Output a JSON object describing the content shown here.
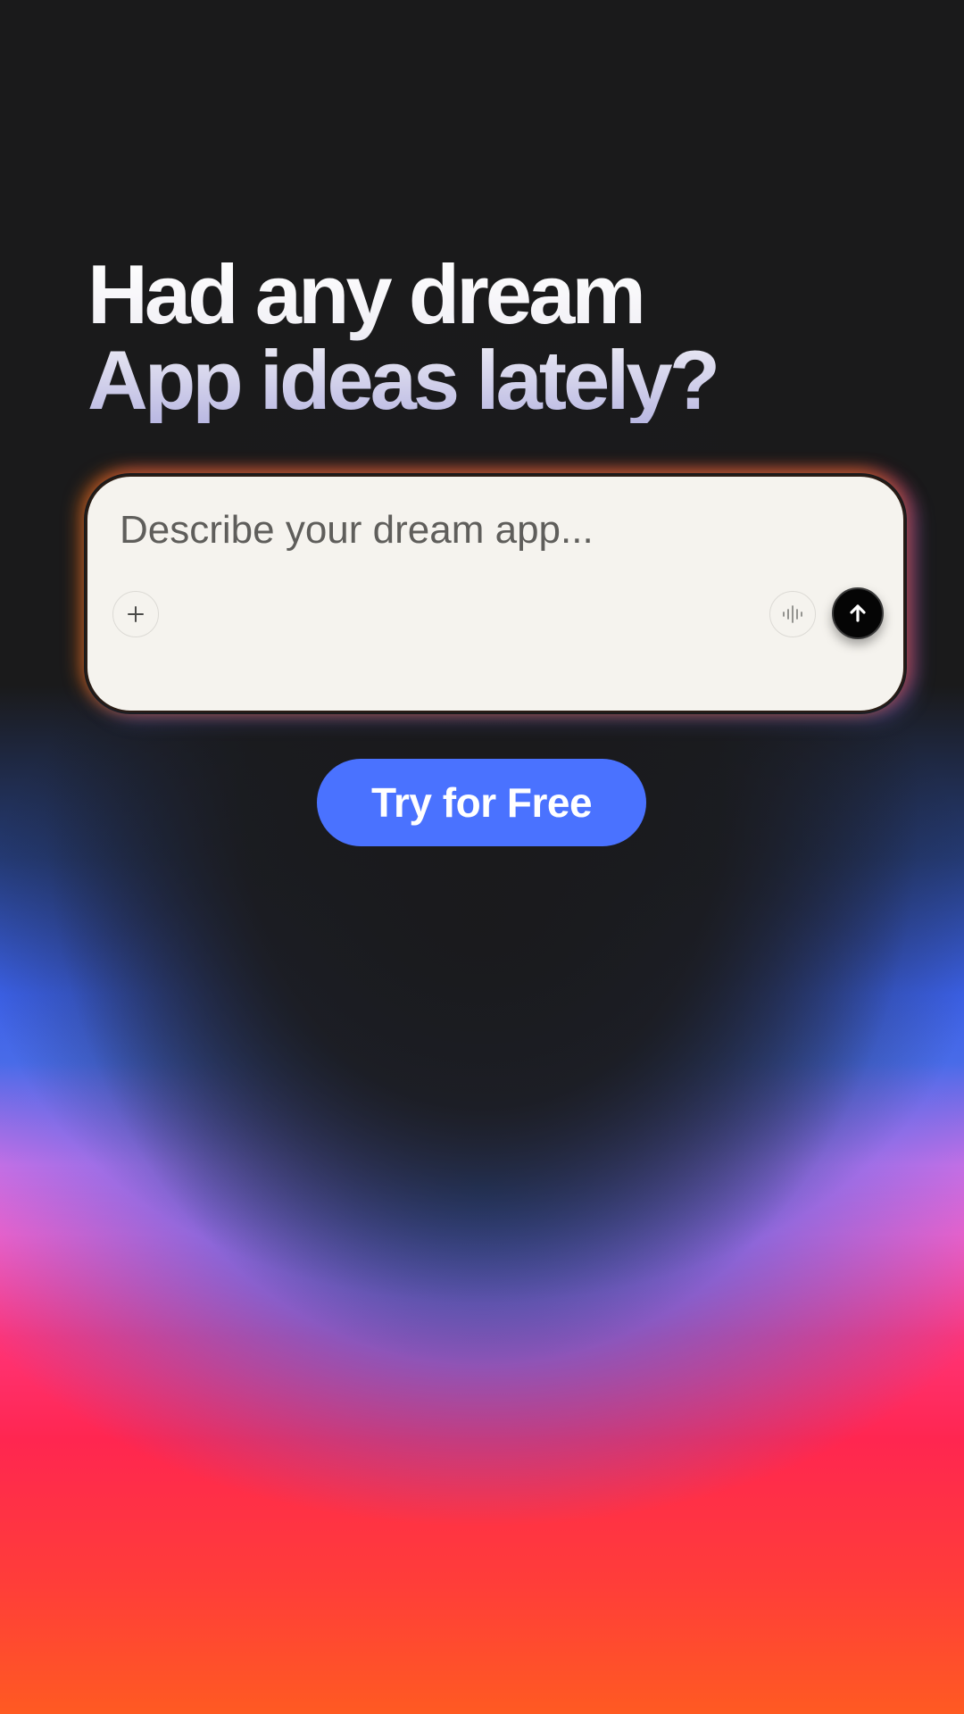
{
  "headline": {
    "line1": "Had any dream",
    "line2": "App ideas lately?"
  },
  "prompt": {
    "placeholder": "Describe your dream app...",
    "value": ""
  },
  "buttons": {
    "add_icon": "plus-icon",
    "voice_icon": "waveform-icon",
    "send_icon": "arrow-up-icon"
  },
  "cta": {
    "label": "Try for Free"
  },
  "colors": {
    "background": "#1a1a1b",
    "card": "#f5f3ee",
    "cta": "#4a72ff",
    "send": "#050505",
    "gradient_blue": "#3b60e6",
    "gradient_pink": "#ff5fc6",
    "gradient_red": "#ff2650",
    "gradient_orange": "#ff5a22"
  }
}
